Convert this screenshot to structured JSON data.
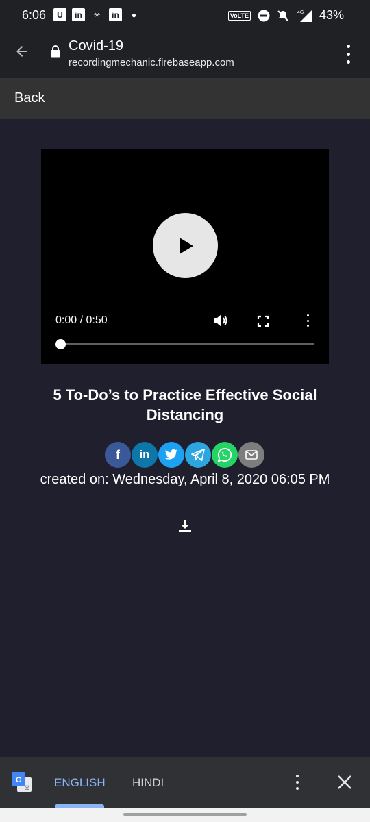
{
  "status": {
    "time": "6:06",
    "left_icons": [
      "U",
      "in",
      "✳",
      "in",
      "●"
    ],
    "volte": "VoLTE",
    "network": "4G",
    "battery": "43%"
  },
  "url_bar": {
    "title": "Covid-19",
    "domain": "recordingmechanic.firebaseapp.com"
  },
  "nav": {
    "back_label": "Back"
  },
  "video": {
    "time_display": "0:00 / 0:50",
    "progress_fraction": 0.0
  },
  "article": {
    "title": "5 To-Do’s to Practice Effective Social Distancing",
    "created": "created on: Wednesday, April 8, 2020 06:05 PM",
    "share": [
      {
        "name": "facebook",
        "glyph": "f",
        "color": "#3b5998"
      },
      {
        "name": "linkedin",
        "glyph": "in",
        "color": "#0e76a8"
      },
      {
        "name": "twitter",
        "glyph": "🐦",
        "color": "#1da1f2"
      },
      {
        "name": "telegram",
        "glyph": "➤",
        "color": "#2ca5e0"
      },
      {
        "name": "whatsapp",
        "glyph": "☏",
        "color": "#25d366"
      },
      {
        "name": "email",
        "glyph": "✉",
        "color": "#7d7d7d"
      }
    ]
  },
  "translate": {
    "lang_source": "ENGLISH",
    "lang_target": "HINDI"
  }
}
